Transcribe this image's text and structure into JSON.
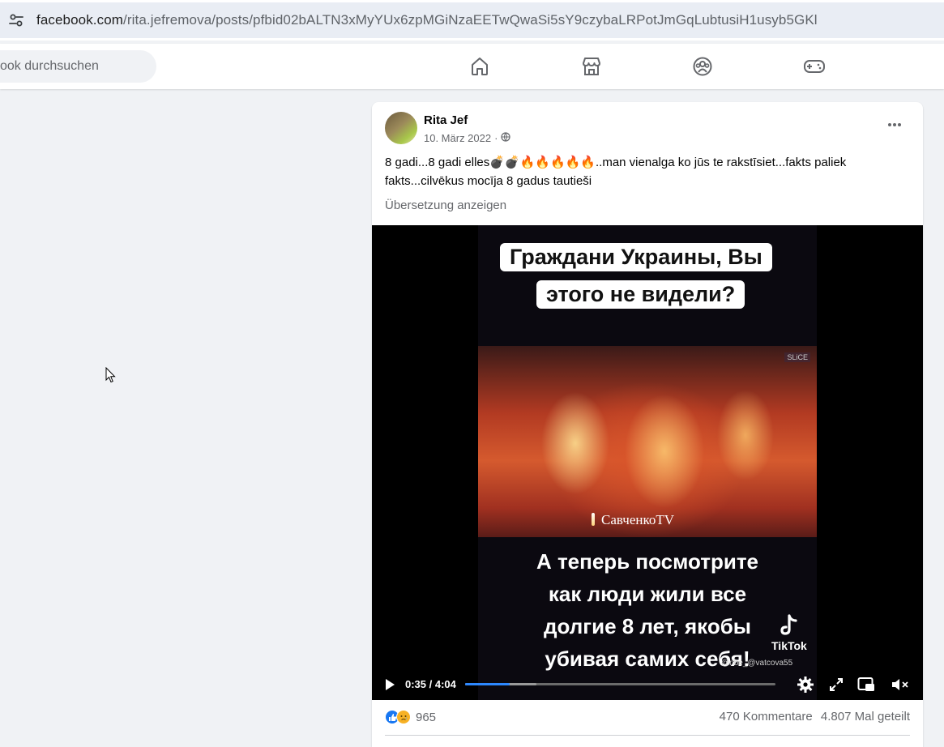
{
  "browser": {
    "url_domain": "facebook.com",
    "url_path": "/rita.jefremova/posts/pfbid02bALTN3xMyYUx6zpMGiNzaEETwQwaSi5sY9czybaLRPotJmGqLubtusiH1usyb5GKl",
    "site_info_icon": "tune-icon"
  },
  "nav": {
    "search_placeholder": "ook durchsuchen",
    "icons": [
      "home-icon",
      "marketplace-icon",
      "groups-icon",
      "gaming-icon"
    ]
  },
  "post": {
    "author": "Rita Jef",
    "date": "10. März 2022",
    "audience_icon": "globe-icon",
    "text": "8 gadi...8 gadi elles💣💣🔥🔥🔥🔥🔥..man vienalga ko jūs te rakstīsiet...fakts paliek fakts...cilvēkus mocīja 8 gadus tautieši",
    "translate_label": "Übersetzung anzeigen",
    "video": {
      "top_caption_line1": "Граждани Украины, Вы",
      "top_caption_line2": "этого не видели?",
      "channel_watermark": "СавченкоTV",
      "corner_logo": "SLiCE",
      "bottom_line1": "А теперь посмотрите",
      "bottom_line2": "как люди жили все",
      "bottom_line3": "долгие 8 лет, якобы",
      "bottom_line4": "убивая самих себя!",
      "tiktok_label": "TikTok",
      "tiktok_handle": "@ribe_@vatcova55",
      "time_display": "0:35 / 4:04",
      "progress_fraction": 0.143,
      "buffered_fraction": 0.23
    },
    "reactions": {
      "count": "965",
      "icons": [
        "like-icon",
        "sad-icon"
      ]
    },
    "comments": "470 Kommentare",
    "shares": "4.807 Mal geteilt"
  }
}
